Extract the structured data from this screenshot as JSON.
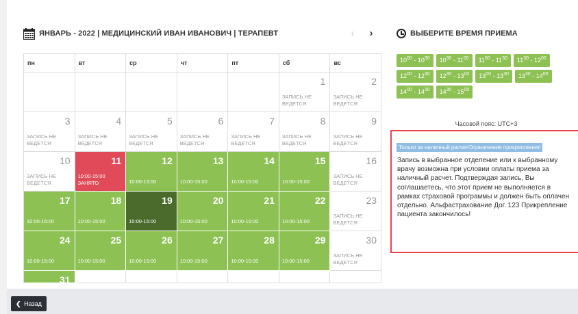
{
  "header": {
    "title": "ЯНВАРЬ - 2022 | МЕДИЦИНСКИЙ ИВАН ИВАНОВИЧ | ТЕРАПЕВТ",
    "prev_icon": "‹",
    "next_icon": "›"
  },
  "weekdays": [
    "пн",
    "вт",
    "ср",
    "чт",
    "пт",
    "сб",
    "вс"
  ],
  "days": {
    "d1": {
      "num": "1",
      "note": "ЗАПИСЬ НЕ ВЕДЕТСЯ"
    },
    "d2": {
      "num": "2",
      "note": "ЗАПИСЬ НЕ ВЕДЕТСЯ"
    },
    "d3": {
      "num": "3",
      "note": "ЗАПИСЬ НЕ ВЕДЕТСЯ"
    },
    "d4": {
      "num": "4",
      "note": "ЗАПИСЬ НЕ ВЕДЕТСЯ"
    },
    "d5": {
      "num": "5",
      "note": "ЗАПИСЬ НЕ ВЕДЕТСЯ"
    },
    "d6": {
      "num": "6",
      "note": "ЗАПИСЬ НЕ ВЕДЕТСЯ"
    },
    "d7": {
      "num": "7",
      "note": "ЗАПИСЬ НЕ ВЕДЕТСЯ"
    },
    "d8": {
      "num": "8",
      "note": "ЗАПИСЬ НЕ ВЕДЕТСЯ"
    },
    "d9": {
      "num": "9",
      "note": "ЗАПИСЬ НЕ ВЕДЕТСЯ"
    },
    "d10": {
      "num": "10",
      "note": "ЗАПИСЬ НЕ ВЕДЕТСЯ"
    },
    "d11": {
      "num": "11",
      "time": "10:00-15:00",
      "status": "ЗАНЯТО"
    },
    "d12": {
      "num": "12",
      "time": "10:00-15:00"
    },
    "d13": {
      "num": "13",
      "time": "10:00-15:00"
    },
    "d14": {
      "num": "14",
      "time": "10:00-15:00"
    },
    "d15": {
      "num": "15",
      "time": "10:00-15:00"
    },
    "d16": {
      "num": "16",
      "note": "ЗАПИСЬ НЕ ВЕДЕТСЯ"
    },
    "d17": {
      "num": "17",
      "time": "10:00-15:00"
    },
    "d18": {
      "num": "18",
      "time": "10:00-15:00"
    },
    "d19": {
      "num": "19",
      "time": "10:00-15:00"
    },
    "d20": {
      "num": "20",
      "time": "10:00-15:00"
    },
    "d21": {
      "num": "21",
      "time": "10:00-15:00"
    },
    "d22": {
      "num": "22",
      "time": "10:00-15:00"
    },
    "d23": {
      "num": "23",
      "note": "ЗАПИСЬ НЕ ВЕДЕТСЯ"
    },
    "d24": {
      "num": "24",
      "time": "10:00-15:00"
    },
    "d25": {
      "num": "25",
      "time": "10:00-15:00"
    },
    "d26": {
      "num": "26",
      "time": "10:00-15:00"
    },
    "d27": {
      "num": "27",
      "time": "10:00-15:00"
    },
    "d28": {
      "num": "28",
      "time": "10:00-15:00"
    },
    "d29": {
      "num": "29",
      "time": "10:00-15:00"
    },
    "d30": {
      "num": "30",
      "note": "ЗАПИСЬ НЕ ВЕДЕТСЯ"
    },
    "d31": {
      "num": "31"
    }
  },
  "slots_panel": {
    "title": "ВЫБЕРИТЕ ВРЕМЯ ПРИЕМА",
    "clock_icon": "clock-icon",
    "slots": [
      {
        "h1": "10",
        "m1": "00",
        "h2": "10",
        "m2": "30"
      },
      {
        "h1": "10",
        "m1": "30",
        "h2": "11",
        "m2": "00"
      },
      {
        "h1": "11",
        "m1": "00",
        "h2": "11",
        "m2": "30"
      },
      {
        "h1": "11",
        "m1": "30",
        "h2": "12",
        "m2": "00"
      },
      {
        "h1": "12",
        "m1": "00",
        "h2": "12",
        "m2": "30"
      },
      {
        "h1": "12",
        "m1": "30",
        "h2": "13",
        "m2": "00"
      },
      {
        "h1": "13",
        "m1": "00",
        "h2": "13",
        "m2": "30"
      },
      {
        "h1": "13",
        "m1": "30",
        "h2": "14",
        "m2": "00"
      },
      {
        "h1": "14",
        "m1": "00",
        "h2": "14",
        "m2": "30"
      },
      {
        "h1": "14",
        "m1": "30",
        "h2": "15",
        "m2": "00"
      }
    ],
    "timezone": "Часовой пояс: UTC+3"
  },
  "notice": {
    "badge": "Только за наличный расчетОграничение прикрепления!",
    "text": "Запись в выбранное отделение или к выбранному врачу возможна при условии оплаты приема за наличный расчет. Подтверждая запись, Вы соглашаетесь, что этот прием не выполняется в рамках страховой программы и должен быть оплачен отдельно. Альфастрахование Дог. 123 Прикрепление пациента закончилось!"
  },
  "footer": {
    "back_label": "Назад"
  },
  "colors": {
    "available": "#8dc153",
    "busy": "#e04a59",
    "selected": "#4b6b2c",
    "notice_border": "#e8434a",
    "badge": "#8fbde4"
  }
}
